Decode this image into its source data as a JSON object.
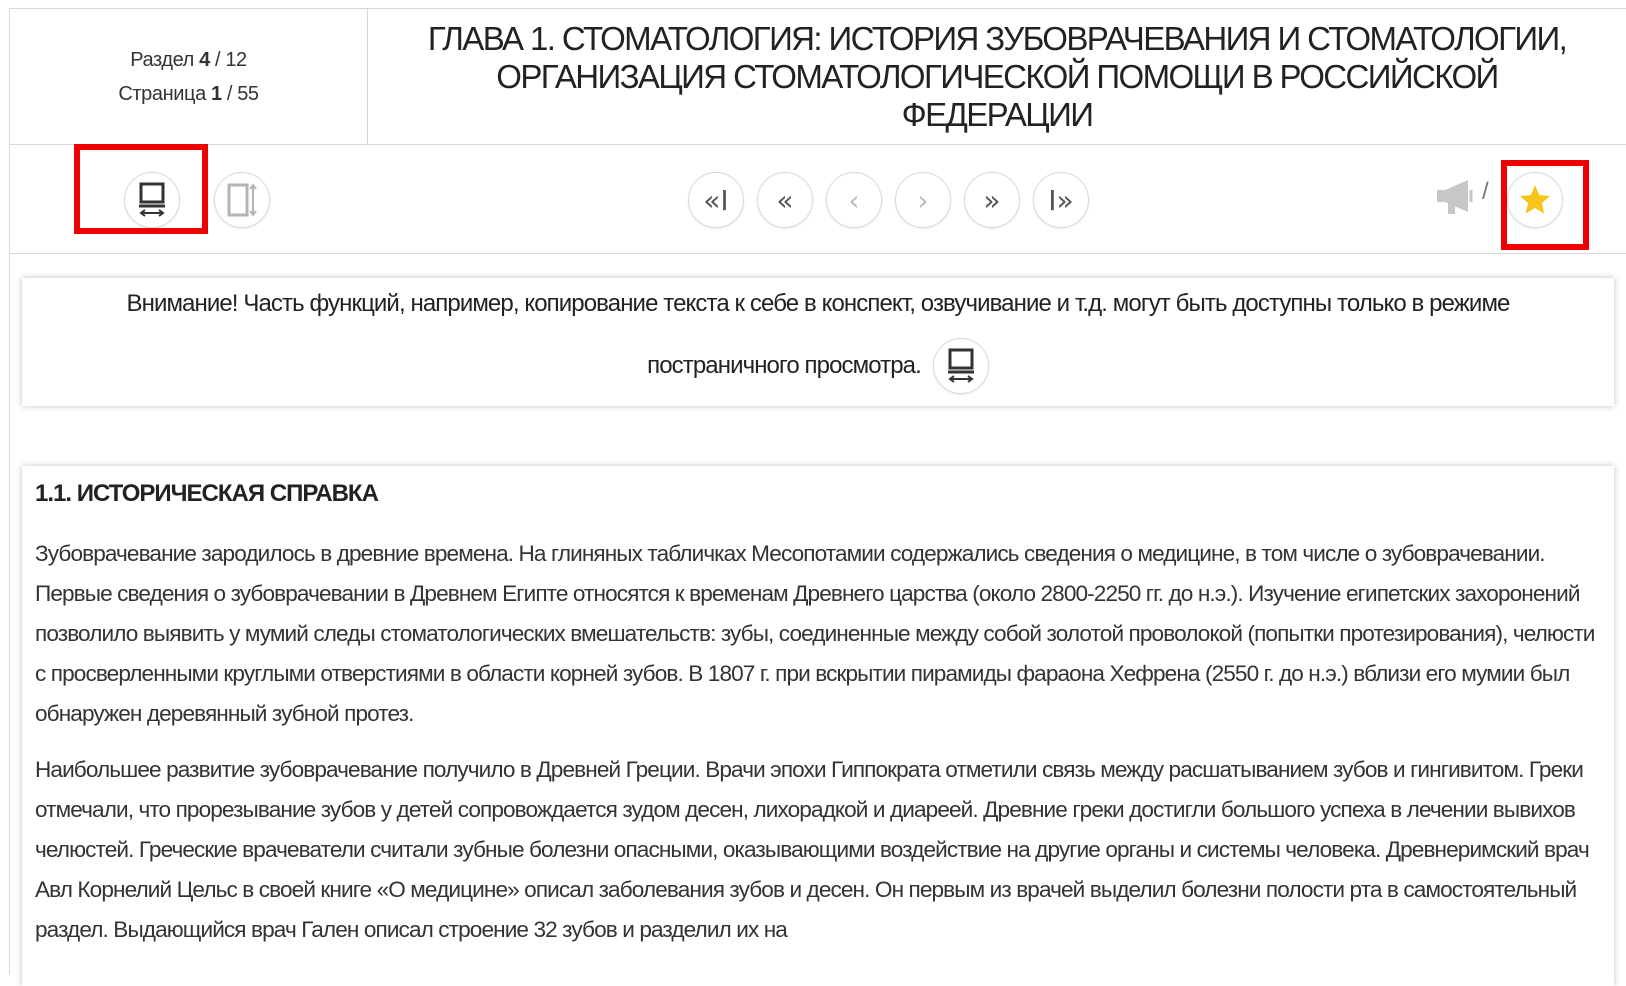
{
  "header": {
    "section_label": "Раздел",
    "section_current": "4",
    "section_total": "/ 12",
    "page_label": "Страница",
    "page_current": "1",
    "page_total": "/ 55",
    "chapter_title": "Глава 1. СТОМАТОЛОГИЯ: ИСТОРИЯ ЗУБОВРАЧЕВАНИЯ И СТОМАТОЛОГИИ, ОРГАНИЗАЦИЯ СТОМАТОЛОГИЧЕСКОЙ ПОМОЩИ В РОССИЙСКОЙ ФЕДЕРАЦИИ"
  },
  "toolbar": {
    "view_modes": [
      {
        "icon": "page-view-icon",
        "active": true,
        "highlighted": true
      },
      {
        "icon": "scroll-view-icon",
        "active": false
      }
    ],
    "nav": [
      {
        "icon": "first-section-icon",
        "glyph": "«I"
      },
      {
        "icon": "prev-section-icon",
        "glyph": "«"
      },
      {
        "icon": "prev-page-icon",
        "glyph": "‹"
      },
      {
        "icon": "next-page-icon",
        "glyph": "›"
      },
      {
        "icon": "next-section-icon",
        "glyph": "»"
      },
      {
        "icon": "last-section-icon",
        "glyph": "I»"
      }
    ],
    "speaker_icon": "megaphone-icon",
    "separator": "/",
    "bookmark_icon": "star-icon",
    "bookmark_color": "#f5c518",
    "highlight_color": "#ee0000"
  },
  "notice": {
    "line1": "Внимание! Часть функций, например, копирование текста к себе в конспект, озвучивание и т.д. могут быть доступны только в режиме",
    "line2": "постраничного просмотра.",
    "icon": "page-view-icon"
  },
  "content": {
    "section_title": "1.1. ИСТОРИЧЕСКАЯ СПРАВКА",
    "paragraphs": [
      "Зубоврачевание зародилось в древние времена. На глиняных табличках Месопотамии содержались сведения о медицине, в том числе о зубоврачевании. Первые сведения о зубоврачевании в Древнем Египте относятся к временам Древнего царства (около 2800-2250 гг. до н.э.). Изучение египетских захоронений позволило выявить у мумий следы стоматологических вмешательств: зубы, соединенные между собой золотой проволокой (попытки протезирования), челюсти с просверленными круглыми отверстиями в области корней зубов. В 1807 г. при вскрытии пирамиды фараона Хефрена (2550 г. до н.э.) вблизи его мумии был обнаружен деревянный зубной протез.",
      "Наибольшее развитие зубоврачевание получило в Древней Греции. Врачи эпохи Гиппократа отметили связь между расшатыванием зубов и гингивитом. Греки отмечали, что прорезывание зубов у детей сопровождается зудом десен, лихорадкой и диареей. Древние греки достигли большого успеха в лечении вывихов челюстей. Греческие врачеватели считали зубные болезни опасными, оказывающими воздействие на другие органы и системы человека. Древнеримский врач Авл Корнелий Цельс в своей книге «О медицине» описал заболевания зубов и десен. Он первым из врачей выделил болезни полости рта в самостоятельный раздел. Выдающийся врач Гален описал строение 32 зубов и разделил их на"
    ]
  }
}
